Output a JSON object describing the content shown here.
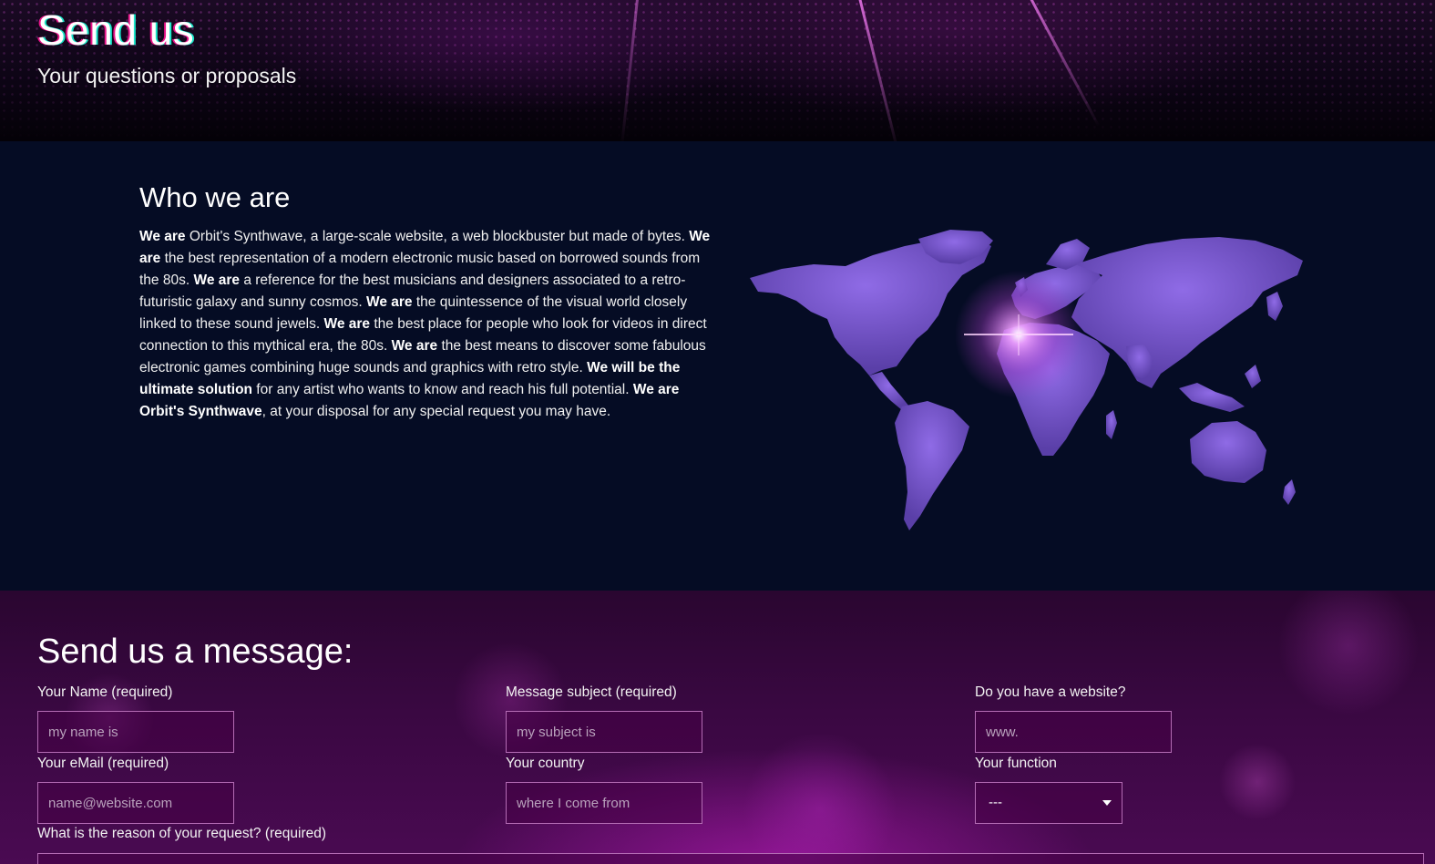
{
  "hero": {
    "title": "Send us",
    "subtitle": "Your questions or proposals"
  },
  "about": {
    "title": "Who we are",
    "paragraph": [
      {
        "bold": true,
        "text": "We are"
      },
      {
        "bold": false,
        "text": " Orbit's Synthwave, a large-scale website, a web blockbuster but made of bytes. "
      },
      {
        "bold": true,
        "text": "We are"
      },
      {
        "bold": false,
        "text": " the best representation of a modern electronic music based on borrowed sounds from the 80s. "
      },
      {
        "bold": true,
        "text": "We are"
      },
      {
        "bold": false,
        "text": " a reference for the best musicians and designers associated to a retro-futuristic galaxy and sunny cosmos. "
      },
      {
        "bold": true,
        "text": "We are"
      },
      {
        "bold": false,
        "text": " the quintessence of the visual world closely linked to these sound jewels. "
      },
      {
        "bold": true,
        "text": "We are"
      },
      {
        "bold": false,
        "text": " the best place for people who look for videos in direct connection to this mythical era, the 80s. "
      },
      {
        "bold": true,
        "text": "We are"
      },
      {
        "bold": false,
        "text": " the best means to discover some fabulous electronic games combining huge sounds and graphics with retro style. "
      },
      {
        "bold": true,
        "text": "We will be the ultimate solution"
      },
      {
        "bold": false,
        "text": " for any artist who wants to know and reach his full potential. "
      },
      {
        "bold": true,
        "text": "We are Orbit's Synthwave"
      },
      {
        "bold": false,
        "text": ", at your disposal for any special request you may have."
      }
    ],
    "map_icon": "world-map-icon",
    "map_color": "#6a4fc4",
    "glow_color": "#e070ff"
  },
  "contact": {
    "title": "Send us a message:",
    "fields": {
      "name": {
        "label": "Your Name (required)",
        "placeholder": "my name is"
      },
      "email": {
        "label": "Your eMail (required)",
        "placeholder": "name@website.com"
      },
      "subject": {
        "label": "Message subject (required)",
        "placeholder": "my subject is"
      },
      "country": {
        "label": "Your country",
        "placeholder": "where I come from"
      },
      "website": {
        "label": "Do you have a website?",
        "placeholder": "www."
      },
      "function": {
        "label": "Your function",
        "selected": "---",
        "options": [
          "---"
        ]
      },
      "reason": {
        "label": "What is the reason of your request? (required)"
      }
    }
  },
  "colors": {
    "page_background": "#050c24",
    "accent_magenta": "#e8148a",
    "accent_cyan": "#19e6c9",
    "field_border": "#b46cb4"
  }
}
